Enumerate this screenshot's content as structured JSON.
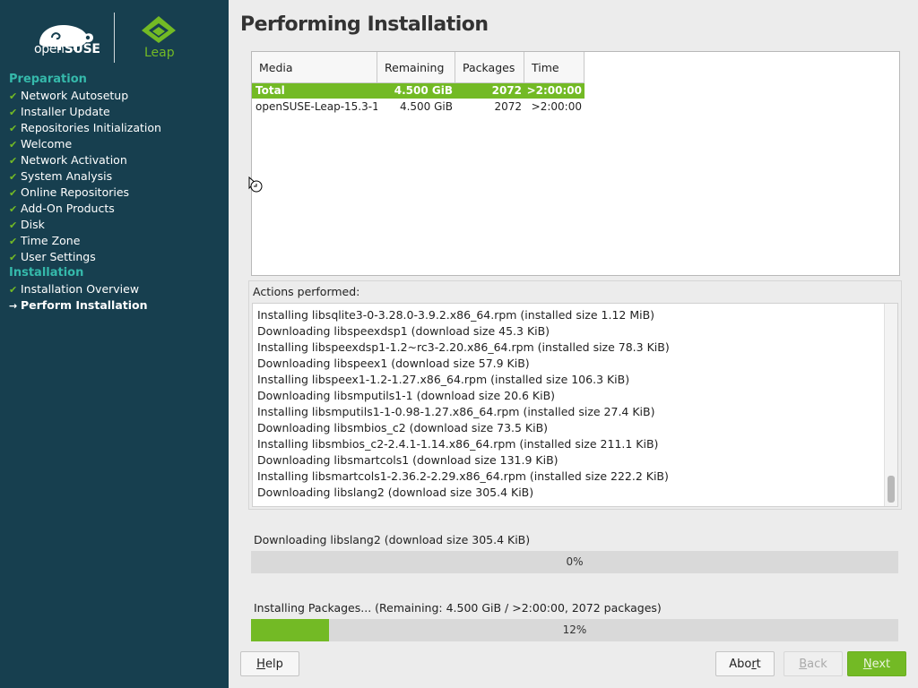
{
  "brand": {
    "suse_text_light": "open",
    "suse_text_bold": "SUSE",
    "leap_text": "Leap"
  },
  "sidebar": {
    "sections": [
      {
        "label": "Preparation",
        "steps": [
          {
            "label": "Network Autosetup",
            "state": "done"
          },
          {
            "label": "Installer Update",
            "state": "done"
          },
          {
            "label": "Repositories Initialization",
            "state": "done"
          },
          {
            "label": "Welcome",
            "state": "done"
          },
          {
            "label": "Network Activation",
            "state": "done"
          },
          {
            "label": "System Analysis",
            "state": "done"
          },
          {
            "label": "Online Repositories",
            "state": "done"
          },
          {
            "label": "Add-On Products",
            "state": "done"
          },
          {
            "label": "Disk",
            "state": "done"
          },
          {
            "label": "Time Zone",
            "state": "done"
          },
          {
            "label": "User Settings",
            "state": "done"
          }
        ]
      },
      {
        "label": "Installation",
        "steps": [
          {
            "label": "Installation Overview",
            "state": "done"
          },
          {
            "label": "Perform Installation",
            "state": "current"
          }
        ]
      }
    ],
    "done_mark": "✔",
    "current_mark": "→"
  },
  "main": {
    "title": "Performing Installation"
  },
  "media_table": {
    "headers": [
      "Media",
      "Remaining",
      "Packages",
      "Time"
    ],
    "rows": [
      {
        "media": "Total",
        "remaining": "4.500 GiB",
        "packages": "2072",
        "time": ">2:00:00",
        "selected": true
      },
      {
        "media": "openSUSE-Leap-15.3-1",
        "remaining": "4.500 GiB",
        "packages": "2072",
        "time": ">2:00:00",
        "selected": false
      }
    ]
  },
  "actions": {
    "label": "Actions performed:",
    "lines": [
      "Installing libsqlite3-0-3.28.0-3.9.2.x86_64.rpm (installed size 1.12 MiB)",
      "Downloading libspeexdsp1 (download size 45.3 KiB)",
      "Installing libspeexdsp1-1.2~rc3-2.20.x86_64.rpm (installed size 78.3 KiB)",
      "Downloading libspeex1 (download size 57.9 KiB)",
      "Installing libspeex1-1.2-1.27.x86_64.rpm (installed size 106.3 KiB)",
      "Downloading libsmputils1-1 (download size 20.6 KiB)",
      "Installing libsmputils1-1-0.98-1.27.x86_64.rpm (installed size 27.4 KiB)",
      "Downloading libsmbios_c2 (download size 73.5 KiB)",
      "Installing libsmbios_c2-2.4.1-1.14.x86_64.rpm (installed size 211.1 KiB)",
      "Downloading libsmartcols1 (download size 131.9 KiB)",
      "Installing libsmartcols1-2.36.2-2.29.x86_64.rpm (installed size 222.2 KiB)",
      "Downloading libslang2 (download size 305.4 KiB)"
    ]
  },
  "progress": {
    "current_label": "Downloading libslang2 (download size 305.4 KiB)",
    "current_text": "0%",
    "current_fraction": 0.0,
    "total_label": "Installing Packages... (Remaining: 4.500 GiB / >2:00:00, 2072 packages)",
    "total_text": "12%",
    "total_fraction": 0.12
  },
  "buttons": {
    "help": {
      "pre": "",
      "ul": "H",
      "post": "elp"
    },
    "abort": {
      "pre": "Abo",
      "ul": "r",
      "post": "t"
    },
    "back": {
      "pre": "",
      "ul": "B",
      "post": "ack",
      "disabled": true
    },
    "next": {
      "pre": "",
      "ul": "N",
      "post": "ext"
    }
  },
  "colors": {
    "accent": "#73ba25",
    "sidebar_bg": "#173f4f",
    "section_heading": "#35b9ab"
  }
}
